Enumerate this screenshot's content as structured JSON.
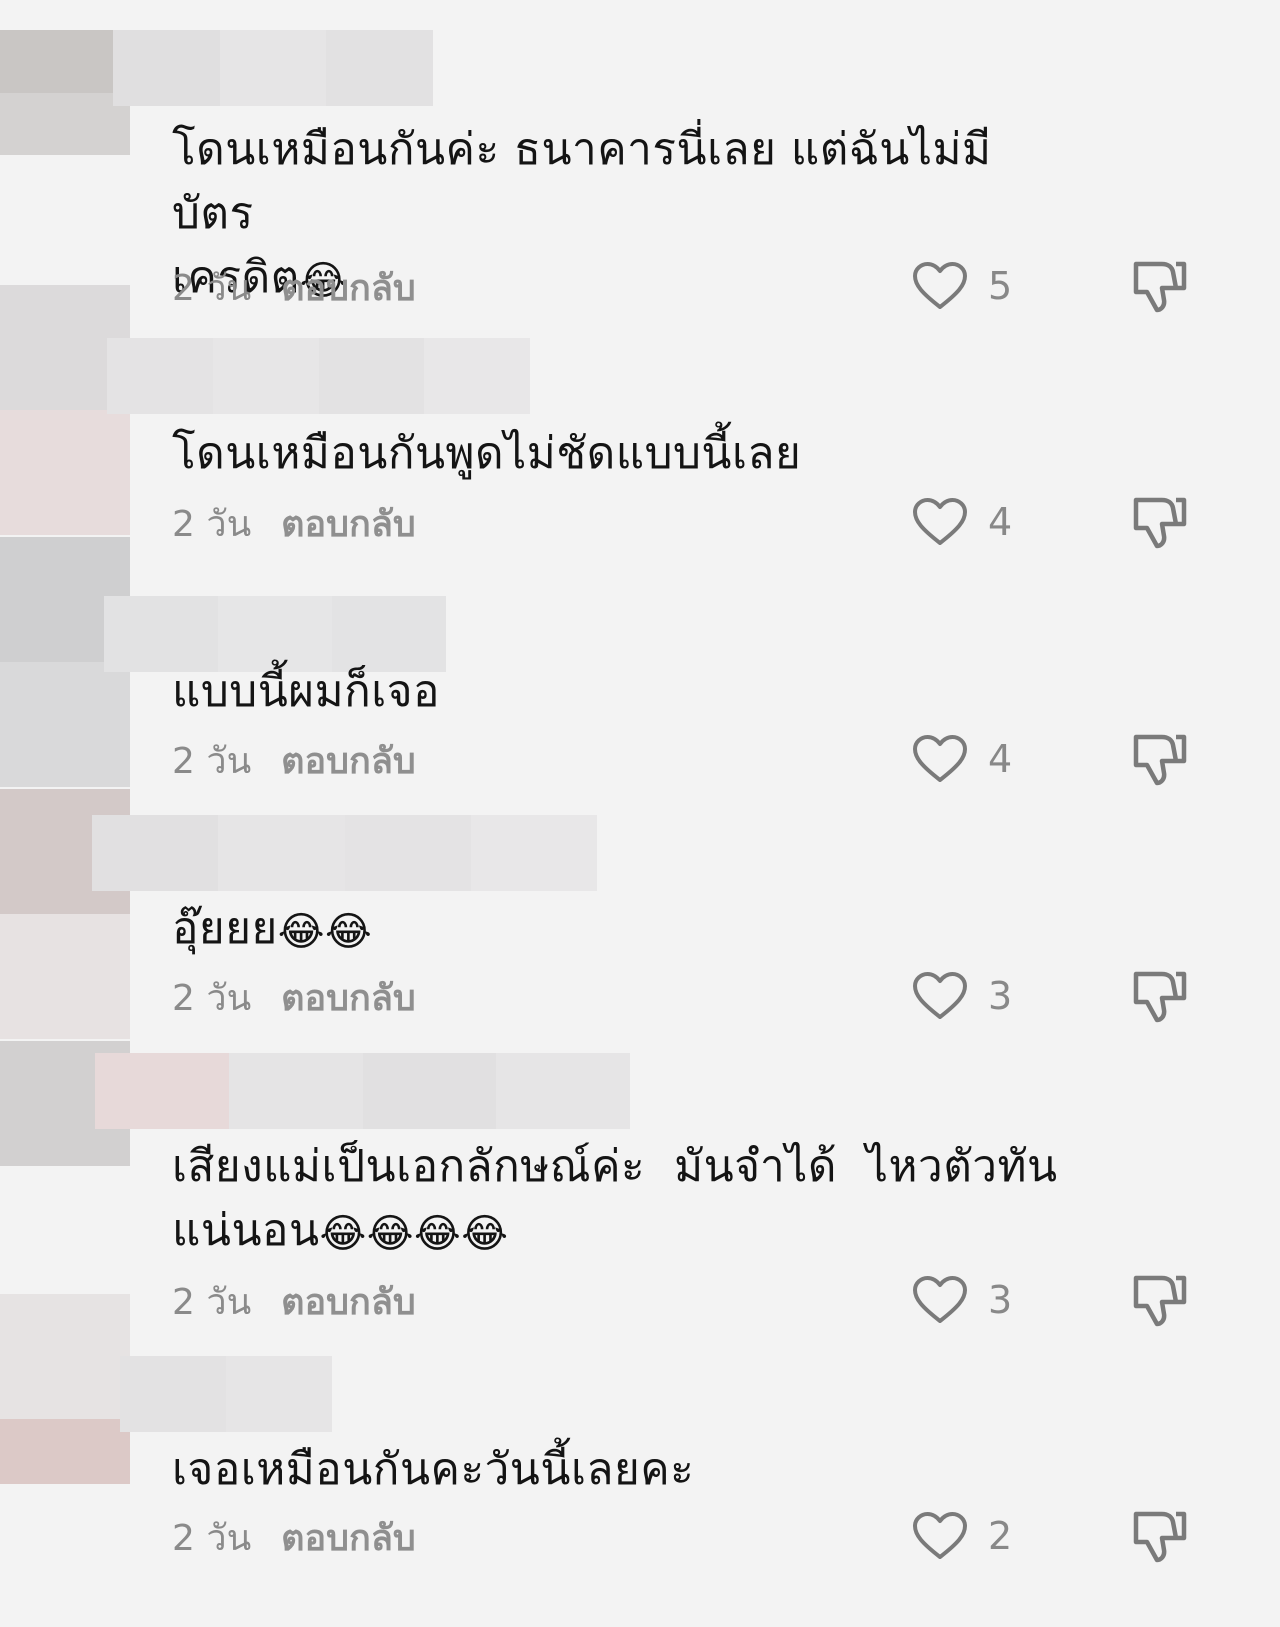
{
  "colors": {
    "background": "#f3f3f3",
    "text": "#141414",
    "meta": "#8a8a8a",
    "icon": "#7a7a7a"
  },
  "reply_label": "ตอบกลับ",
  "comments": [
    {
      "text": "โดนเหมือนกันค่ะ ธนาคารนี่เลย แต่ฉันไม่มีบัตร\nเครดิต",
      "emoji": "😂",
      "time": "2 วัน",
      "likes": "5"
    },
    {
      "text": "โดนเหมือนกันพูดไม่ชัดแบบนี้เลย",
      "emoji": "",
      "time": "2 วัน",
      "likes": "4"
    },
    {
      "text": "แบบนี้ผมก็เจอ",
      "emoji": "",
      "time": "2 วัน",
      "likes": "4"
    },
    {
      "text": "อุ๊ยยย",
      "emoji": "😂😂",
      "time": "2 วัน",
      "likes": "3"
    },
    {
      "text": "เสียงแม่เป็นเอกลักษณ์ค่ะ  มันจำได้  ไหวตัวทัน\nแน่นอน",
      "emoji": "😂😂😂😂",
      "time": "2 วัน",
      "likes": "3"
    },
    {
      "text": "เจอเหมือนกันคะวันนี้เลยคะ",
      "emoji": "",
      "time": "2 วัน",
      "likes": "2"
    }
  ]
}
